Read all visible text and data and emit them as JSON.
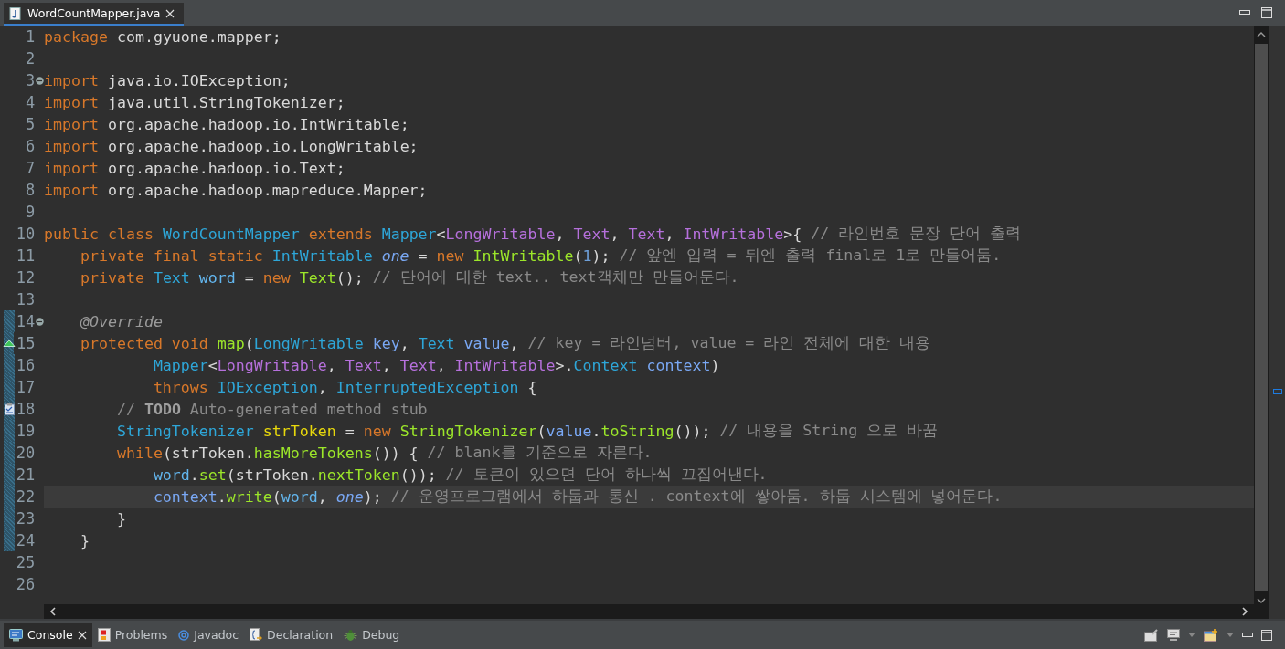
{
  "editor_tabs": [
    {
      "label": "WordCountMapper.java",
      "selected": true
    }
  ],
  "lines": [
    {
      "number": "1",
      "current": false,
      "changed": false,
      "tokens": [
        {
          "kind": "keyword",
          "text": "package"
        },
        {
          "kind": "plain",
          "text": " com.gyuone.mapper;"
        }
      ]
    },
    {
      "number": "2",
      "current": false,
      "changed": false
    },
    {
      "number": "3",
      "current": false,
      "changed": false,
      "kind": "fold",
      "tokens": [
        {
          "kind": "keyword",
          "text": "import"
        },
        {
          "kind": "plain",
          "text": " java.io.IOException;"
        }
      ]
    },
    {
      "number": "4",
      "current": false,
      "changed": false,
      "tokens": [
        {
          "kind": "keyword",
          "text": "import"
        },
        {
          "kind": "plain",
          "text": " java.util.StringTokenizer;"
        }
      ]
    },
    {
      "number": "5",
      "current": false,
      "changed": false,
      "tokens": [
        {
          "kind": "keyword",
          "text": "import"
        },
        {
          "kind": "plain",
          "text": " org.apache.hadoop.io.IntWritable;"
        }
      ]
    },
    {
      "number": "6",
      "current": false,
      "changed": false,
      "tokens": [
        {
          "kind": "keyword",
          "text": "import"
        },
        {
          "kind": "plain",
          "text": " org.apache.hadoop.io.LongWritable;"
        }
      ]
    },
    {
      "number": "7",
      "current": false,
      "changed": false,
      "tokens": [
        {
          "kind": "keyword",
          "text": "import"
        },
        {
          "kind": "plain",
          "text": " org.apache.hadoop.io.Text;"
        }
      ]
    },
    {
      "number": "8",
      "current": false,
      "changed": false,
      "tokens": [
        {
          "kind": "keyword",
          "text": "import"
        },
        {
          "kind": "plain",
          "text": " org.apache.hadoop.mapreduce.Mapper;"
        }
      ]
    },
    {
      "number": "9",
      "current": false,
      "changed": false
    },
    {
      "number": "10",
      "current": false,
      "changed": false,
      "tokens": [
        {
          "kind": "keyword",
          "text": "public class "
        },
        {
          "kind": "type",
          "text": "WordCountMapper"
        },
        {
          "kind": "keyword",
          "text": " extends "
        },
        {
          "kind": "type",
          "text": "Mapper"
        },
        {
          "kind": "plain",
          "text": "<"
        },
        {
          "kind": "typeparam",
          "text": "LongWritable"
        },
        {
          "kind": "plain",
          "text": ", "
        },
        {
          "kind": "typeparam",
          "text": "Text"
        },
        {
          "kind": "plain",
          "text": ", "
        },
        {
          "kind": "typeparam",
          "text": "Text"
        },
        {
          "kind": "plain",
          "text": ", "
        },
        {
          "kind": "typeparam",
          "text": "IntWritable"
        },
        {
          "kind": "plain",
          "text": ">{ "
        },
        {
          "kind": "comment",
          "text": "// 라인번호 문장 단어 출력"
        }
      ],
      "children": [
        {
          "number": "11",
          "current": false,
          "changed": false,
          "tokens": [
            {
              "kind": "keyword",
              "text": "private final static "
            },
            {
              "kind": "type",
              "text": "IntWritable "
            },
            {
              "kind": "static_field",
              "text": "one"
            },
            {
              "kind": "plain",
              "text": " = "
            },
            {
              "kind": "keyword",
              "text": "new "
            },
            {
              "kind": "method",
              "text": "IntWritable"
            },
            {
              "kind": "plain",
              "text": "("
            },
            {
              "kind": "number",
              "text": "1"
            },
            {
              "kind": "plain",
              "text": "); "
            },
            {
              "kind": "comment",
              "text": "// 앞엔 입력 = 뒤엔 출력 final로 1로 만들어둠."
            }
          ]
        },
        {
          "number": "12",
          "current": false,
          "changed": false,
          "tokens": [
            {
              "kind": "keyword",
              "text": "private "
            },
            {
              "kind": "type",
              "text": "Text "
            },
            {
              "kind": "field",
              "text": "word"
            },
            {
              "kind": "plain",
              "text": " = "
            },
            {
              "kind": "keyword",
              "text": "new "
            },
            {
              "kind": "method",
              "text": "Text"
            },
            {
              "kind": "plain",
              "text": "(); "
            },
            {
              "kind": "comment",
              "text": "// 단어에 대한 text.. text객체만 만들어둔다."
            }
          ]
        },
        {
          "number": "13",
          "current": false,
          "changed": false
        },
        {
          "number": "14",
          "current": false,
          "changed": true,
          "kind": "fold",
          "tokens": [
            {
              "kind": "annotation",
              "text": "@Override"
            }
          ]
        },
        {
          "number": "15",
          "current": false,
          "changed": true,
          "kind": "override",
          "tokens": [
            {
              "kind": "keyword",
              "text": "protected void "
            },
            {
              "kind": "method",
              "text": "map"
            },
            {
              "kind": "plain",
              "text": "("
            },
            {
              "kind": "type",
              "text": "LongWritable "
            },
            {
              "kind": "param",
              "text": "key"
            },
            {
              "kind": "plain",
              "text": ", "
            },
            {
              "kind": "type",
              "text": "Text "
            },
            {
              "kind": "param",
              "text": "value"
            },
            {
              "kind": "plain",
              "text": ", "
            },
            {
              "kind": "comment",
              "text": "// key = 라인넘버, value = 라인 전체에 대한 내용"
            }
          ],
          "children": [
            {
              "number": "16",
              "current": false,
              "changed": true,
              "kind": "continuation",
              "tokens": [
                {
                  "kind": "type",
                  "text": "Mapper"
                },
                {
                  "kind": "plain",
                  "text": "<"
                },
                {
                  "kind": "typeparam",
                  "text": "LongWritable"
                },
                {
                  "kind": "plain",
                  "text": ", "
                },
                {
                  "kind": "typeparam",
                  "text": "Text"
                },
                {
                  "kind": "plain",
                  "text": ", "
                },
                {
                  "kind": "typeparam",
                  "text": "Text"
                },
                {
                  "kind": "plain",
                  "text": ", "
                },
                {
                  "kind": "typeparam",
                  "text": "IntWritable"
                },
                {
                  "kind": "plain",
                  "text": ">."
                },
                {
                  "kind": "type",
                  "text": "Context "
                },
                {
                  "kind": "param",
                  "text": "context"
                },
                {
                  "kind": "plain",
                  "text": ")"
                }
              ]
            },
            {
              "number": "17",
              "current": false,
              "changed": true,
              "kind": "continuation",
              "tokens": [
                {
                  "kind": "keyword",
                  "text": "throws "
                },
                {
                  "kind": "type",
                  "text": "IOException"
                },
                {
                  "kind": "plain",
                  "text": ", "
                },
                {
                  "kind": "type",
                  "text": "InterruptedException"
                },
                {
                  "kind": "plain",
                  "text": " {"
                }
              ]
            },
            {
              "number": "18",
              "current": false,
              "changed": true,
              "kind": "task",
              "tokens": [
                {
                  "kind": "comment",
                  "text": "// "
                },
                {
                  "kind": "todo",
                  "text": "TODO"
                },
                {
                  "kind": "comment",
                  "text": " Auto-generated method stub"
                }
              ]
            },
            {
              "number": "19",
              "current": false,
              "changed": true,
              "tokens": [
                {
                  "kind": "type",
                  "text": "StringTokenizer "
                },
                {
                  "kind": "local",
                  "text": "strToken"
                },
                {
                  "kind": "plain",
                  "text": " = "
                },
                {
                  "kind": "keyword",
                  "text": "new "
                },
                {
                  "kind": "method",
                  "text": "StringTokenizer"
                },
                {
                  "kind": "plain",
                  "text": "("
                },
                {
                  "kind": "param",
                  "text": "value"
                },
                {
                  "kind": "plain",
                  "text": "."
                },
                {
                  "kind": "method",
                  "text": "toString"
                },
                {
                  "kind": "plain",
                  "text": "()); "
                },
                {
                  "kind": "comment",
                  "text": "// 내용을 String 으로 바꿈"
                }
              ]
            },
            {
              "number": "20",
              "current": false,
              "changed": true,
              "tokens": [
                {
                  "kind": "keyword",
                  "text": "while"
                },
                {
                  "kind": "plain",
                  "text": "(strToken."
                },
                {
                  "kind": "method",
                  "text": "hasMoreTokens"
                },
                {
                  "kind": "plain",
                  "text": "()) { "
                },
                {
                  "kind": "comment",
                  "text": "// blank를 기준으로 자른다."
                }
              ],
              "children": [
                {
                  "number": "21",
                  "current": false,
                  "changed": true,
                  "tokens": [
                    {
                      "kind": "field",
                      "text": "word"
                    },
                    {
                      "kind": "plain",
                      "text": "."
                    },
                    {
                      "kind": "method",
                      "text": "set"
                    },
                    {
                      "kind": "plain",
                      "text": "(strToken."
                    },
                    {
                      "kind": "method",
                      "text": "nextToken"
                    },
                    {
                      "kind": "plain",
                      "text": "()); "
                    },
                    {
                      "kind": "comment",
                      "text": "// 토큰이 있으면 단어 하나씩 끄집어낸다."
                    }
                  ]
                },
                {
                  "number": "22",
                  "current": true,
                  "changed": true,
                  "tokens": [
                    {
                      "kind": "param",
                      "text": "context"
                    },
                    {
                      "kind": "plain",
                      "text": "."
                    },
                    {
                      "kind": "method",
                      "text": "write"
                    },
                    {
                      "kind": "plain",
                      "text": "("
                    },
                    {
                      "kind": "field",
                      "text": "word"
                    },
                    {
                      "kind": "plain",
                      "text": ", "
                    },
                    {
                      "kind": "static_field",
                      "text": "one"
                    },
                    {
                      "kind": "plain",
                      "text": "); "
                    },
                    {
                      "kind": "comment",
                      "text": "// 운영프로그램에서 하둡과 통신 . context에 쌓아둠. 하둡 시스템에 넣어둔다."
                    }
                  ]
                }
              ]
            },
            {
              "number": "23",
              "current": false,
              "changed": true,
              "tokens": [
                {
                  "kind": "plain",
                  "text": "}"
                }
              ]
            }
          ]
        },
        {
          "number": "24",
          "current": false,
          "changed": true,
          "tokens": [
            {
              "kind": "plain",
              "text": "}"
            }
          ]
        }
      ]
    },
    {
      "number": "25",
      "current": false,
      "changed": false
    },
    {
      "number": "26",
      "current": false,
      "changed": false
    }
  ],
  "bottom_tabs": [
    {
      "label": "Console",
      "selected": true
    },
    {
      "label": "Problems",
      "selected": false
    },
    {
      "label": "Javadoc",
      "selected": false
    },
    {
      "label": "Declaration",
      "selected": false
    },
    {
      "label": "Debug",
      "selected": false
    }
  ]
}
